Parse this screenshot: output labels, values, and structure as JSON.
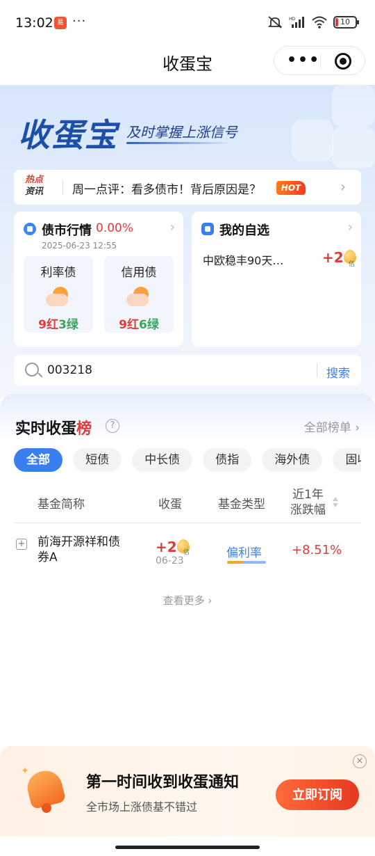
{
  "status_bar": {
    "time": "13:02",
    "app_icon": "notification-app-icon",
    "dots": "···",
    "battery_level": "10"
  },
  "nav": {
    "title": "收蛋宝",
    "more_icon": "more-dots-icon",
    "close_icon": "target-circle-icon"
  },
  "hero": {
    "logo": "收蛋宝",
    "slogan": "及时掌握上涨信号"
  },
  "hot_news": {
    "tag_line1": "热点",
    "tag_line2": "资讯",
    "text": "周一点评：看多债市！背后原因是？",
    "badge": "HOT"
  },
  "market_card": {
    "title": "债市行情",
    "change": "0.00%",
    "time": "2025-06-23 12:55",
    "items": [
      {
        "name": "利率债",
        "red_count": "9",
        "red_label": "红",
        "green_count": "3",
        "green_label": "绿"
      },
      {
        "name": "信用债",
        "red_count": "9",
        "red_label": "红",
        "green_count": "6",
        "green_label": "绿"
      }
    ]
  },
  "watchlist_card": {
    "title": "我的自选",
    "item_name": "中欧稳丰90天…",
    "item_value": "+2",
    "egg_tag": "佶"
  },
  "search": {
    "value": "003218",
    "button": "搜索"
  },
  "ranking": {
    "title_prefix": "实时收蛋",
    "title_suffix": "榜",
    "help": "?",
    "all_link": "全部榜单",
    "tabs": [
      "全部",
      "短债",
      "中长债",
      "债指",
      "海外债",
      "固收+"
    ],
    "headers": {
      "name": "基金简称",
      "eggs": "收蛋",
      "type": "基金类型",
      "change_line1": "近1年",
      "change_line2": "涨跌幅"
    },
    "rows": [
      {
        "name": "前海开源祥和债券A",
        "eggs": "+2",
        "egg_tag": "佶",
        "date": "06-23",
        "type": "偏利率",
        "change": "+8.51%"
      }
    ],
    "more": "查看更多"
  },
  "banner": {
    "title": "第一时间收到收蛋通知",
    "subtitle": "全市场上涨债基不错过",
    "button": "立即订阅",
    "close": "×"
  },
  "colors": {
    "brand_blue": "#3a7ff0",
    "up_red": "#e03b3b",
    "down_green": "#3aa55a",
    "cta_orange": "#e6391f"
  }
}
